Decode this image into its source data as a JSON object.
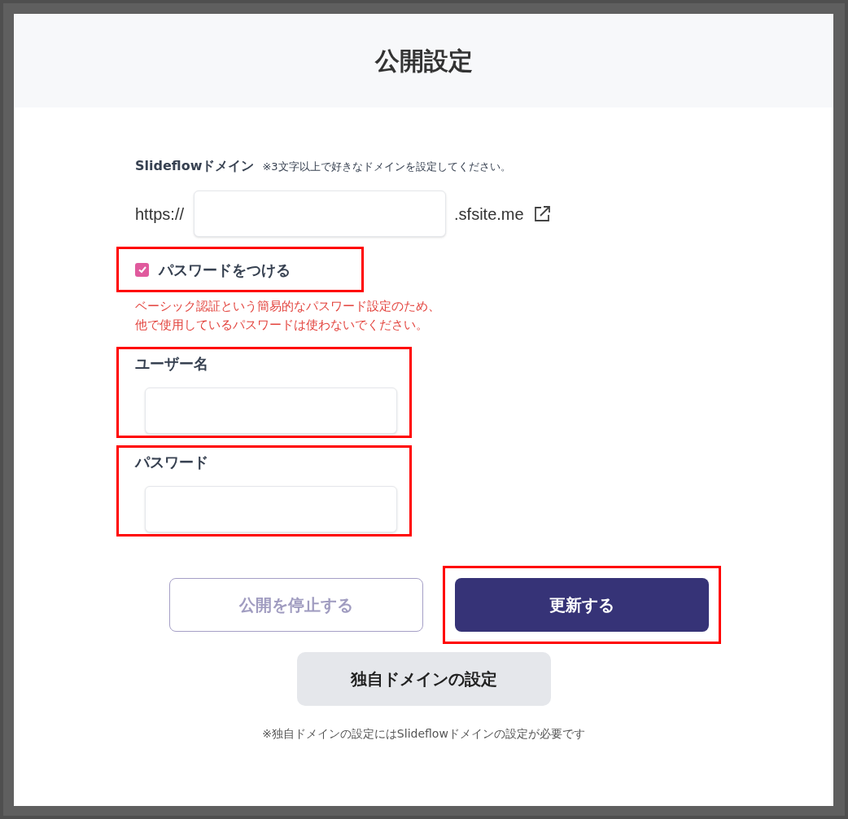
{
  "dialog": {
    "title": "公開設定"
  },
  "domain": {
    "label": "Slideflowドメイン",
    "hint": "※3文字以上で好きなドメインを設定してください。",
    "prefix": "https://",
    "suffix": ".sfsite.me"
  },
  "password_toggle": {
    "label": "パスワードをつける",
    "checked": true,
    "highlighted": true,
    "warning": [
      "ベーシック認証という簡易的なパスワード設定のため、",
      "他で使用しているパスワードは使わないでください。"
    ]
  },
  "fields": [
    {
      "label": "ユーザー名",
      "highlighted": true
    },
    {
      "label": "パスワード",
      "highlighted": true
    }
  ],
  "buttons": [
    {
      "label": "公開を停止する",
      "kind": "outline",
      "highlighted": false
    },
    {
      "label": "更新する",
      "kind": "primary",
      "highlighted": true
    }
  ],
  "custom_domain_button": {
    "label": "独自ドメインの設定"
  },
  "note": "※独自ドメインの設定にはSlideflowドメインの設定が必要です"
}
